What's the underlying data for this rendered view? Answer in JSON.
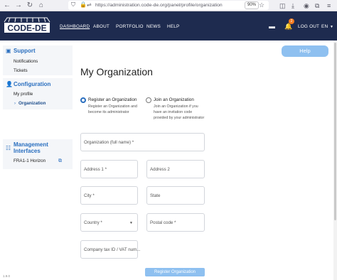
{
  "browser": {
    "url": "https://administration.code-de.org/panel/profile/organization",
    "zoom": "90%"
  },
  "header": {
    "logo_text": "CODE-DE",
    "nav": [
      "DASHBOARD",
      "ABOUT",
      "PORTFOLIO",
      "NEWS",
      "HELP"
    ],
    "active_nav": "DASHBOARD",
    "notification_count": "2",
    "logout_label": "LOG OUT",
    "language": "EN"
  },
  "sidebar": {
    "support": {
      "title": "Support",
      "items": [
        "Notifications",
        "Tickets"
      ]
    },
    "configuration": {
      "title": "Configuration",
      "items": [
        "My profile",
        "Organization"
      ],
      "active_item": "Organization"
    },
    "management": {
      "title_line1": "Management",
      "title_line2": "Interfaces",
      "items": [
        "FRA1-1 Horizon"
      ]
    }
  },
  "main": {
    "help_label": "Help",
    "title": "My Organization",
    "options": [
      {
        "label": "Register an Organization",
        "desc_line1": "Register an Organization and",
        "desc_line2": "become its administrator",
        "selected": true
      },
      {
        "label": "Join an Organization",
        "desc_line1": "Join an Organization if you",
        "desc_line2": "have an invitation code",
        "desc_line3": "provided by your administrator",
        "selected": false
      }
    ],
    "fields": {
      "org_name": "Organization (full name) *",
      "address1": "Address 1 *",
      "address2": "Address 2",
      "city": "City *",
      "state": "State",
      "country": "Country *",
      "postal": "Postal code *",
      "tax_id": "Company tax ID / VAT num..."
    },
    "submit_label": "Register Organization"
  },
  "footer": {
    "version": "1.9.0"
  },
  "colors": {
    "header_bg": "#1e2b4f",
    "accent": "#2a6fbf",
    "button": "#8ec0f0",
    "badge": "#f47c20"
  }
}
